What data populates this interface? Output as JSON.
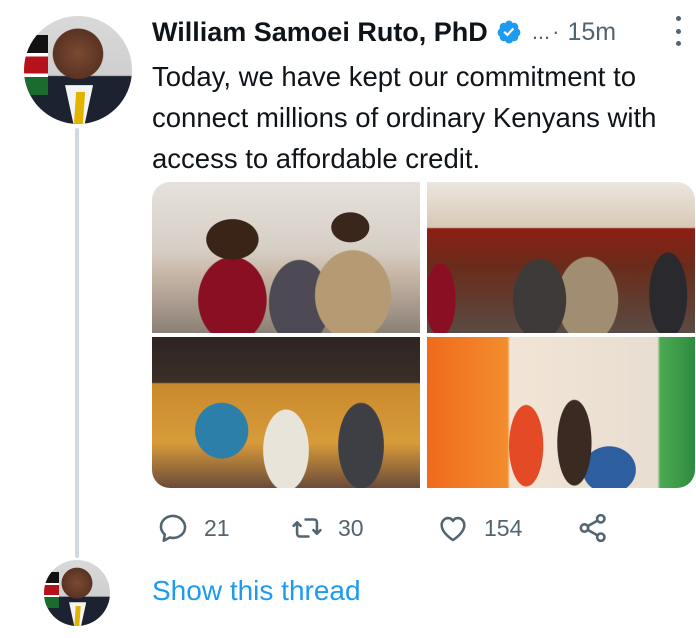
{
  "tweet": {
    "author_name": "William Samoei Ruto, PhD",
    "handle": "...",
    "dot": "·",
    "time": "15m",
    "text": "Today, we have kept our commitment to connect millions of ordinary Kenyans with access to affordable credit.",
    "media": [
      {
        "photo": "photo-1"
      },
      {
        "photo": "photo-2"
      },
      {
        "photo": "photo-3"
      },
      {
        "photo": "photo-4"
      }
    ]
  },
  "actions": {
    "reply_count": "21",
    "retweet_count": "30",
    "like_count": "154"
  },
  "thread": {
    "show_thread_label": "Show this thread"
  },
  "icons": {
    "verified": "verified-badge-icon",
    "more": "more-options-icon",
    "reply": "reply-icon",
    "retweet": "retweet-icon",
    "like": "heart-icon",
    "share": "share-icon"
  },
  "colors": {
    "accent": "#1d9bf0",
    "secondary_text": "#536471",
    "thread_line": "#cfd9de"
  }
}
